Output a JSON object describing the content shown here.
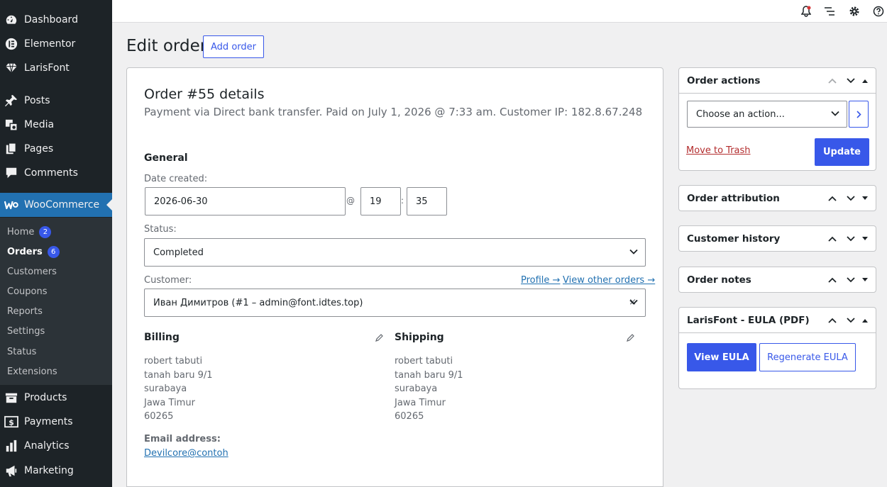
{
  "sidebar": {
    "items": [
      {
        "label": "Dashboard",
        "icon": "dashboard-icon"
      },
      {
        "label": "Elementor",
        "icon": "elementor-icon"
      },
      {
        "label": "LarisFont",
        "icon": "diamond-icon"
      },
      {
        "label": "Posts",
        "icon": "pin-icon"
      },
      {
        "label": "Media",
        "icon": "media-icon"
      },
      {
        "label": "Pages",
        "icon": "pages-icon"
      },
      {
        "label": "Comments",
        "icon": "comment-icon"
      },
      {
        "label": "WooCommerce",
        "icon": "woo-icon"
      },
      {
        "label": "Products",
        "icon": "archive-icon"
      },
      {
        "label": "Payments",
        "icon": "dollar-icon"
      },
      {
        "label": "Analytics",
        "icon": "chart-bar-icon"
      },
      {
        "label": "Marketing",
        "icon": "megaphone-icon"
      }
    ],
    "submenu": [
      {
        "label": "Home",
        "badge": "2"
      },
      {
        "label": "Orders",
        "badge": "6"
      },
      {
        "label": "Customers"
      },
      {
        "label": "Coupons"
      },
      {
        "label": "Reports"
      },
      {
        "label": "Settings"
      },
      {
        "label": "Status"
      },
      {
        "label": "Extensions"
      }
    ]
  },
  "header": {
    "title": "Edit order",
    "add_order_label": "Add order"
  },
  "order": {
    "heading": "Order #55 details",
    "meta": "Payment via Direct bank transfer. Paid on July 1, 2026 @ 7:33 am. Customer IP: 182.8.67.248",
    "general_title": "General",
    "date_label": "Date created:",
    "date_value": "2026-06-30",
    "at_sign": "@",
    "hour_value": "19",
    "colon": ":",
    "minute_value": "35",
    "status_label": "Status:",
    "status_value": "Completed",
    "customer_label": "Customer:",
    "profile_link": "Profile →",
    "other_orders_link": "View other orders →",
    "customer_value": "Иван Димитров (#1 – admin@font.idtes.top)",
    "clear_mark": "×",
    "billing": {
      "title": "Billing",
      "lines": [
        "robert tabuti",
        "tanah baru 9/1",
        "surabaya",
        "Jawa Timur",
        "60265"
      ],
      "email_label": "Email address:",
      "email_value": "Devilcore@contoh"
    },
    "shipping": {
      "title": "Shipping",
      "lines": [
        "robert tabuti",
        "tanah baru 9/1",
        "surabaya",
        "Jawa Timur",
        "60265"
      ]
    }
  },
  "actions_box": {
    "title": "Order actions",
    "select_value": "Choose an action...",
    "trash_link": "Move to Trash",
    "update_label": "Update"
  },
  "attribution_box": {
    "title": "Order attribution"
  },
  "history_box": {
    "title": "Customer history"
  },
  "notes_box": {
    "title": "Order notes"
  },
  "eula_box": {
    "title": "LarisFont - EULA (PDF)",
    "view_label": "View EULA",
    "regen_label": "Regenerate EULA"
  },
  "colors": {
    "sidebar_bg": "#1d2327",
    "active_menu": "#2271b1",
    "primary_button": "#3858e9",
    "link": "#2271b1",
    "trash_link": "#b32d2e"
  }
}
